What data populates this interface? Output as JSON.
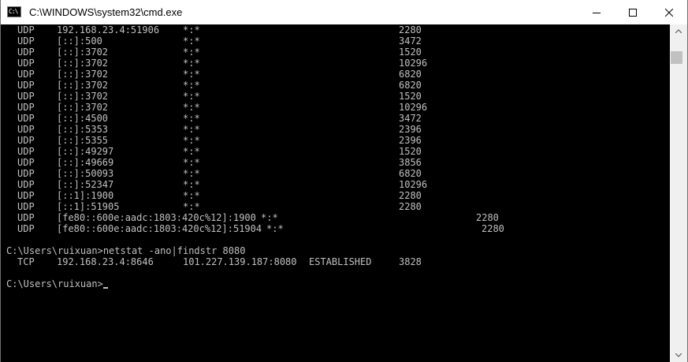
{
  "window": {
    "title": "C:\\WINDOWS\\system32\\cmd.exe",
    "icon_text": "C:\\"
  },
  "controls": {
    "minimize": "minimize-icon",
    "maximize": "maximize-icon",
    "close": "close-icon"
  },
  "console": {
    "lines": [
      {
        "proto": "UDP",
        "local": "192.168.23.4:51906",
        "foreign": "*:*",
        "pid": "2280"
      },
      {
        "proto": "UDP",
        "local": "[::]:500",
        "foreign": "*:*",
        "pid": "3472"
      },
      {
        "proto": "UDP",
        "local": "[::]:3702",
        "foreign": "*:*",
        "pid": "1520"
      },
      {
        "proto": "UDP",
        "local": "[::]:3702",
        "foreign": "*:*",
        "pid": "10296"
      },
      {
        "proto": "UDP",
        "local": "[::]:3702",
        "foreign": "*:*",
        "pid": "6820"
      },
      {
        "proto": "UDP",
        "local": "[::]:3702",
        "foreign": "*:*",
        "pid": "6820"
      },
      {
        "proto": "UDP",
        "local": "[::]:3702",
        "foreign": "*:*",
        "pid": "1520"
      },
      {
        "proto": "UDP",
        "local": "[::]:3702",
        "foreign": "*:*",
        "pid": "10296"
      },
      {
        "proto": "UDP",
        "local": "[::]:4500",
        "foreign": "*:*",
        "pid": "3472"
      },
      {
        "proto": "UDP",
        "local": "[::]:5353",
        "foreign": "*:*",
        "pid": "2396"
      },
      {
        "proto": "UDP",
        "local": "[::]:5355",
        "foreign": "*:*",
        "pid": "2396"
      },
      {
        "proto": "UDP",
        "local": "[::]:49297",
        "foreign": "*:*",
        "pid": "1520"
      },
      {
        "proto": "UDP",
        "local": "[::]:49669",
        "foreign": "*:*",
        "pid": "3856"
      },
      {
        "proto": "UDP",
        "local": "[::]:50093",
        "foreign": "*:*",
        "pid": "6820"
      },
      {
        "proto": "UDP",
        "local": "[::]:52347",
        "foreign": "*:*",
        "pid": "10296"
      },
      {
        "proto": "UDP",
        "local": "[::1]:1900",
        "foreign": "*:*",
        "pid": "2280"
      },
      {
        "proto": "UDP",
        "local": "[::1]:51905",
        "foreign": "*:*",
        "pid": "2280"
      },
      {
        "proto": "UDP",
        "local": "[fe80::600e:aadc:1803:420c%12]:1900",
        "foreign": "*:*",
        "pid": "2280"
      },
      {
        "proto": "UDP",
        "local": "[fe80::600e:aadc:1803:420c%12]:51904",
        "foreign": "*:*",
        "pid": "2280"
      }
    ],
    "command": "C:\\Users\\ruixuan>netstat -ano|findstr 8080",
    "tcp_row": {
      "proto": "TCP",
      "local": "192.168.23.4:8646",
      "foreign": "101.227.139.187:8080",
      "state": "ESTABLISHED",
      "pid": "3828"
    },
    "prompt": "C:\\Users\\ruixuan>"
  },
  "scrollbar": {
    "up": "scroll-up-arrow-icon",
    "down": "scroll-down-arrow-icon"
  }
}
